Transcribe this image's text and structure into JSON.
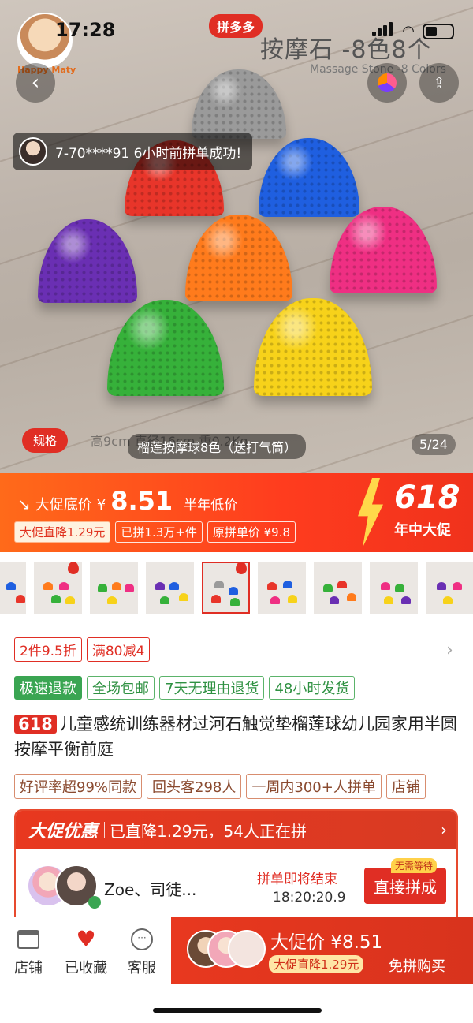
{
  "status": {
    "time": "17:28"
  },
  "hero": {
    "brand_text": "Happy Maty",
    "platform_badge": "拼多多",
    "overlay_title": "按摩石 -8色8个",
    "overlay_subtitle": "Massage Stone -8 Colors",
    "toast": "7-70****91 6小时前拼单成功!",
    "spec_label": "规格",
    "spec_ghost": "高9cm 直径16cm 重0.2Kg",
    "caption": "榴莲按摩球8色（送打气筒）",
    "counter": "5/24",
    "ball_colors": [
      "#9a9a9a",
      "#e8352a",
      "#1f5fe0",
      "#6a2fb3",
      "#ff7b1c",
      "#ef2f83",
      "#36b13a",
      "#f7d21a"
    ]
  },
  "promo": {
    "label": "大促底价",
    "currency": "¥",
    "price": "8.51",
    "half_year": "半年低价",
    "chips": [
      "大促直降1.29元",
      "已拼1.3万+件",
      "原拼单价 ¥9.8"
    ],
    "badge_number": "618",
    "badge_text": "年中大促"
  },
  "coupons": [
    "2件9.5折",
    "满80减4"
  ],
  "services": [
    "极速退款",
    "全场包邮",
    "7天无理由退货",
    "48小时发货"
  ],
  "product": {
    "badge": "618",
    "title": "儿童感统训练器材过河石触觉垫榴莲球幼儿园家用半圆按摩平衡前庭"
  },
  "proofs": [
    "好评率超99%同款",
    "回头客298人",
    "一周内300+人拼单",
    "店铺"
  ],
  "promo_box": {
    "title": "大促优惠",
    "subtitle": "已直降1.29元，54人正在拼",
    "group_name": "Zoe、司徒...",
    "ending_label": "拼单即将结束",
    "timer": "18:20:20.9",
    "no_wait": "无需等待",
    "join_button": "直接拼成"
  },
  "bottom": {
    "store": "店铺",
    "favorited": "已收藏",
    "service": "客服",
    "buy_price": "大促价 ¥8.51",
    "buy_chip": "大促直降1.29元",
    "buy_solo": "免拼购买"
  }
}
